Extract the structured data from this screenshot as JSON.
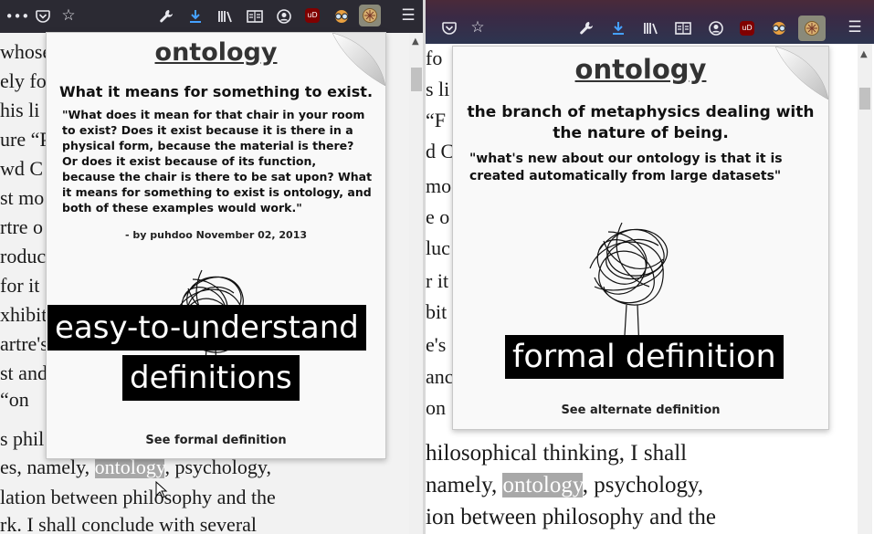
{
  "left": {
    "page_lines": [
      "whose",
      "ely fo",
      "his li",
      "ure “P",
      "wd C",
      "st mo",
      "rtre o",
      "roduc",
      "for it",
      "xhibit",
      "artre's",
      "st and",
      "“on",
      "s phil"
    ],
    "body_lines_before": "es, namely,",
    "highlight": "ontology",
    "body_lines_after": ", psychology,",
    "body_line_2": "lation between philosophy and the",
    "body_line_3": "rk. I shall conclude with several",
    "popup": {
      "word": "ontology",
      "definition": "What it means for something to exist.",
      "example": "\"What does it mean for that chair in your room to exist? Does it exist because it is there in a physical form, because the material is there? Or does it exist because of its function, because the chair is there to be sat upon? What it means for something to exist is ontology, and both of these examples would work.\"",
      "author": "- by puhdoo November 02, 2013",
      "switch_link": "See formal definition"
    },
    "caption_line1": "easy-to-understand",
    "caption_line2": "definitions"
  },
  "right": {
    "page_lines": [
      "fo",
      "s li",
      "“F",
      "d C",
      "mo",
      "e o",
      "luc",
      "r it",
      "bit",
      "e's",
      "anc",
      "on"
    ],
    "body_line_1": "hilosophical thinking, I shall",
    "body_before": "namely,",
    "highlight": "ontology",
    "body_after": ", psychology,",
    "body_line_3": "ion between philosophy and the",
    "popup": {
      "word": "ontology",
      "definition": "the branch of metaphysics dealing with the nature of being.",
      "example": "\"what's new about our ontology is that it is created automatically from large datasets\"",
      "switch_link": "See alternate definition"
    },
    "caption": "formal definition"
  },
  "icons": {
    "overflow": "overflow-menu-icon",
    "pocket": "pocket-icon",
    "bookmark": "star-icon",
    "devtools": "wrench-icon",
    "download": "download-icon",
    "library": "library-icon",
    "reader": "reader-view-icon",
    "account": "account-icon",
    "ublock": "ublock-icon",
    "glasses": "glasses-extension-icon",
    "dictionary": "dictionary-extension-icon",
    "menu": "hamburger-menu-icon"
  },
  "colors": {
    "download_blue": "#45a1ff",
    "highlight": "#a8a8a8",
    "ublock_red": "#800000"
  }
}
